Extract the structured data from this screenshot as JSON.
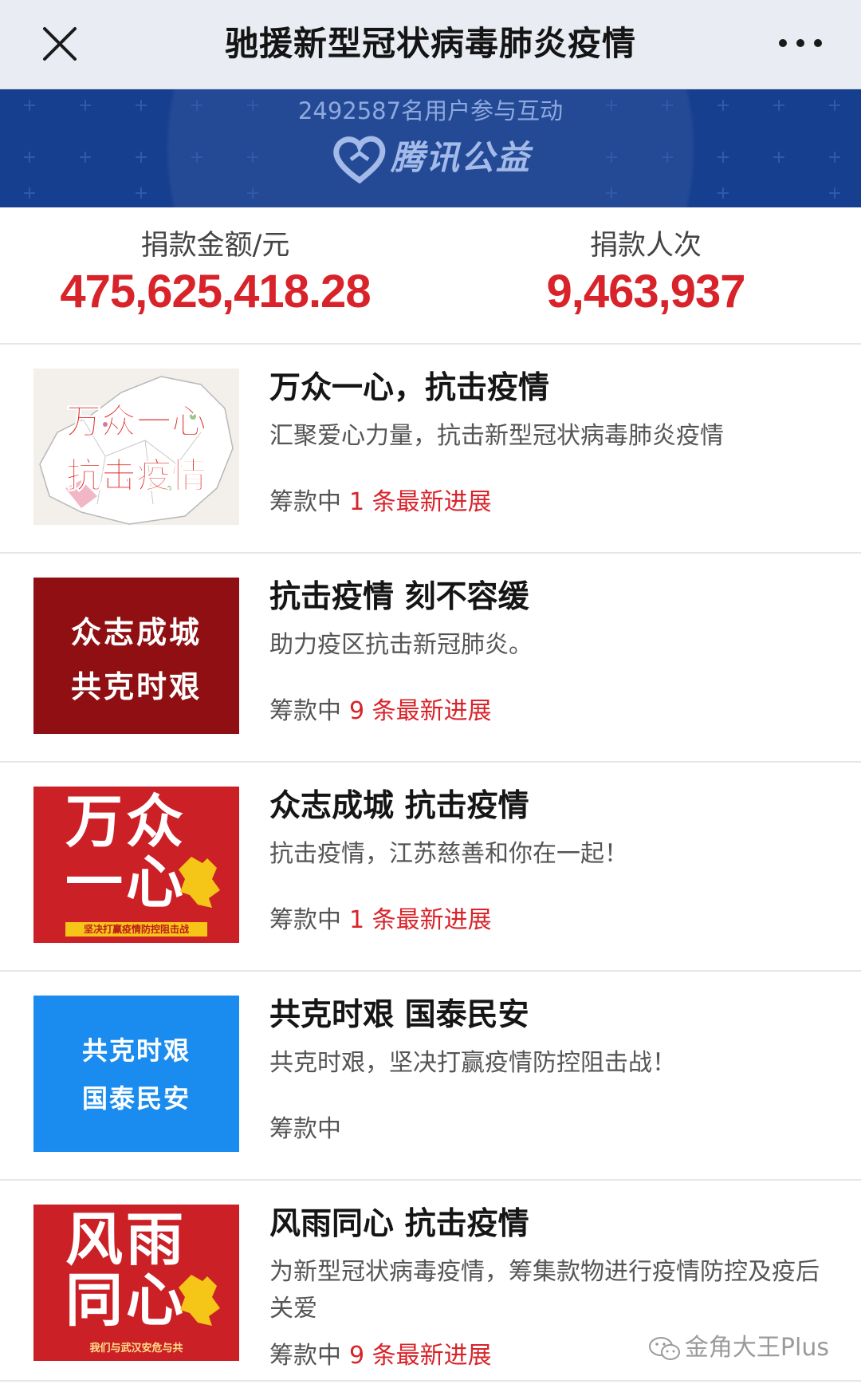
{
  "nav": {
    "title": "驰援新型冠状病毒肺炎疫情"
  },
  "banner": {
    "users_text": "2492587名用户参与互动",
    "logo_text": "腾讯公益"
  },
  "stats": {
    "amount_label": "捐款金额/元",
    "amount_value": "475,625,418.28",
    "donors_label": "捐款人次",
    "donors_value": "9,463,937"
  },
  "projects": [
    {
      "title": "万众一心，抗击疫情",
      "desc": "汇聚爱心力量，抗击新型冠状病毒肺炎疫情",
      "status": "筹款中",
      "updates": "1 条最新进展",
      "thumb_lines": [
        "万众一心",
        "抗击疫情"
      ]
    },
    {
      "title": "抗击疫情 刻不容缓",
      "desc": "助力疫区抗击新冠肺炎。",
      "status": "筹款中",
      "updates": "9 条最新进展",
      "thumb_lines": [
        "众志成城",
        "共克时艰"
      ]
    },
    {
      "title": "众志成城 抗击疫情",
      "desc": "抗击疫情，江苏慈善和你在一起！",
      "status": "筹款中",
      "updates": "1 条最新进展",
      "thumb_lines": [
        "万众",
        "一心",
        "坚决打赢疫情防控阻击战"
      ]
    },
    {
      "title": "共克时艰 国泰民安",
      "desc": "共克时艰，坚决打赢疫情防控阻击战！",
      "status": "筹款中",
      "updates": "",
      "thumb_lines": [
        "共克时艰",
        "国泰民安"
      ]
    },
    {
      "title": "风雨同心 抗击疫情",
      "desc": "为新型冠状病毒疫情，筹集款物进行疫情防控及疫后关爱",
      "status": "筹款中",
      "updates": "9 条最新进展",
      "thumb_lines": [
        "风雨",
        "同心",
        "我们与武汉安危与共"
      ]
    }
  ],
  "watermark": {
    "text": "金角大王Plus"
  },
  "colors": {
    "accent_red": "#d8232a",
    "banner_blue": "#163f8f",
    "thumb_blue": "#1a8cf0",
    "thumb_darkred": "#8f0f12",
    "thumb_red": "#cc2027"
  },
  "icons": {
    "close": "close-icon",
    "more": "more-icon",
    "logo": "heart-logo-icon",
    "watermark": "wechat-icon"
  }
}
